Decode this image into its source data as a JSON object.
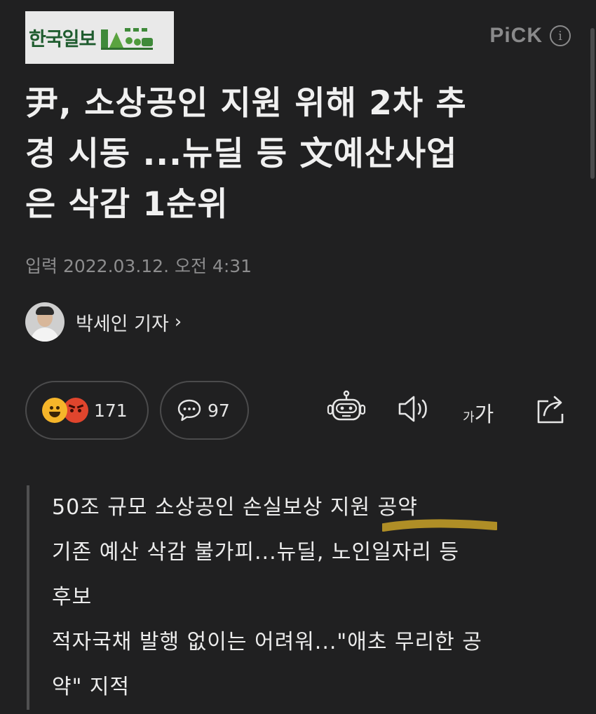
{
  "header": {
    "press_name": "한국일보",
    "pick_label": "PiCK",
    "info_glyph": "i"
  },
  "article": {
    "headline_lines": [
      "尹, 소상공인 지원 위해 2차 추",
      "경 시동 ...뉴딜 등 文예산사업",
      "은 삭감 1순위"
    ],
    "timestamp": "입력 2022.03.12. 오전 4:31",
    "reporter": "박세인 기자",
    "reporter_chevron": "›"
  },
  "actions": {
    "reaction_count": "171",
    "comment_count": "97",
    "font_small": "가",
    "font_large": "가",
    "icons": [
      "smile-emoji-icon",
      "angry-emoji-icon",
      "comment-bubble-icon",
      "robot-summary-icon",
      "speaker-icon",
      "share-icon"
    ]
  },
  "summary": {
    "lines": [
      "50조 규모 소상공인 손실보상 지원 공약",
      "기존 예산 삭감 불가피...뉴딜, 노인일자리 등",
      "후보",
      "적자국채 발행 없이는 어려워...\"애초 무리한 공",
      "약\" 지적"
    ]
  },
  "colors": {
    "background": "#202021",
    "text": "#ebebeb",
    "muted": "#8d8d8e",
    "highlight": "#c9a227",
    "logo_green": "#1f5c2f"
  }
}
